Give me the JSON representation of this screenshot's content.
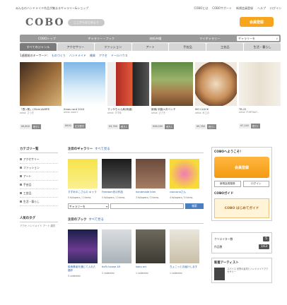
{
  "topbar": {
    "site_text": "みんなのハンドメイド作品が集まるギャラリー&ショップ",
    "links": [
      "COBOとは",
      "COBOサポート",
      "新規会員登録",
      "ヘルプ",
      "ログイン"
    ]
  },
  "header": {
    "logo": "COBO",
    "tagline": "ここからはじめよう",
    "member_button": "会員登録"
  },
  "nav1": {
    "items": [
      "COBOトップ",
      "ギャラリー・ブック",
      "材料市場",
      "マイギャラリー"
    ],
    "search_select": "ギャラリーを"
  },
  "nav2": {
    "items": [
      "すべてのジャンル",
      "アクセサリー",
      "ファッション",
      "アート",
      "手芸品",
      "工芸品",
      "生活・暮らし"
    ]
  },
  "keywords": {
    "label": "1週間前のキーワード:",
    "links": [
      "ものづくり",
      "ハンドメイド",
      "雑貨",
      "アクセ",
      "ドールハウス"
    ]
  },
  "products": [
    {
      "title": "『週ッ靴』(35cm)SARTE",
      "artist": "artist: さつき",
      "price": "¥9,800",
      "badge": "残り1"
    },
    {
      "title": "Xmas card 2010",
      "artist": "artist: kaori t",
      "price": "¥500",
      "badge": "注文受付"
    },
    {
      "title": "マッサちゃん刺(刺繍)",
      "artist": "artist: すずめ",
      "price": "¥3,780",
      "badge": "残り1"
    },
    {
      "title": "新緑(半額)×外ベンチ",
      "artist": "artist: ひでき",
      "price": "¥38,000",
      "badge": "残り1"
    },
    {
      "title": "MO CLOCK",
      "artist": "artist: 木工の",
      "price": "¥9,780",
      "badge": "残り1"
    },
    {
      "title": "TR-22",
      "artist": "artist: PORTRAIT...",
      "price": "¥7,140",
      "badge": "残り1"
    }
  ],
  "categories": {
    "title": "カテゴリ一覧",
    "items": [
      "アクセサリー",
      "ファッション",
      "アート",
      "手芸品",
      "工芸品",
      "生活・暮らし"
    ]
  },
  "tags": {
    "title": "人気のタグ",
    "text": "アクセ ハンドメイド アート 雑貨"
  },
  "gallery": {
    "title": "注目のギャラリー",
    "link": "すべて見る",
    "items": [
      {
        "name": "すずめのこさんの キャラ",
        "meta": "5 followers / 1 items"
      },
      {
        "name": "Freedom氏の作品",
        "meta": "5 followers / 2 items"
      },
      {
        "name": "handmade kirei",
        "meta": "3 followers / 3 items"
      },
      {
        "name": "ciocconaさん",
        "meta": "4 followers / 5 items"
      }
    ]
  },
  "search": {
    "select": "ギャラリーを",
    "button": "検索"
  },
  "books": {
    "title": "注目のブック",
    "link": "すべて見る",
    "items": [
      {
        "name": "飲食業者を通じて入れた額作",
        "meta": "5 collected"
      },
      {
        "name": "tiaTs house 18",
        "meta": "2 collected"
      },
      {
        "name": "kabu art",
        "meta": "1 collected"
      },
      {
        "name": "ちょこっとお届けします",
        "meta": "1 collected"
      }
    ]
  },
  "right": {
    "welcome": "COBOへようこそ！",
    "register_banner": "会員登録",
    "btn_register": "新規会員登録",
    "btn_login": "ログイン",
    "guide_title": "COBOガイド",
    "guide_banner": "COBO はじめてガイド",
    "count_label_1": "クリエイター数",
    "count_value_1": "5",
    "count_label_2": "作品数",
    "count_value_2": "163",
    "artist_title": "新着アーティスト",
    "artist_text": "スパイス 世界の素材とハンドメイドアクセサリー"
  },
  "colors": {
    "accent": "#f7a51c",
    "link": "#2a63a8",
    "nav": "#9a9a9a"
  }
}
